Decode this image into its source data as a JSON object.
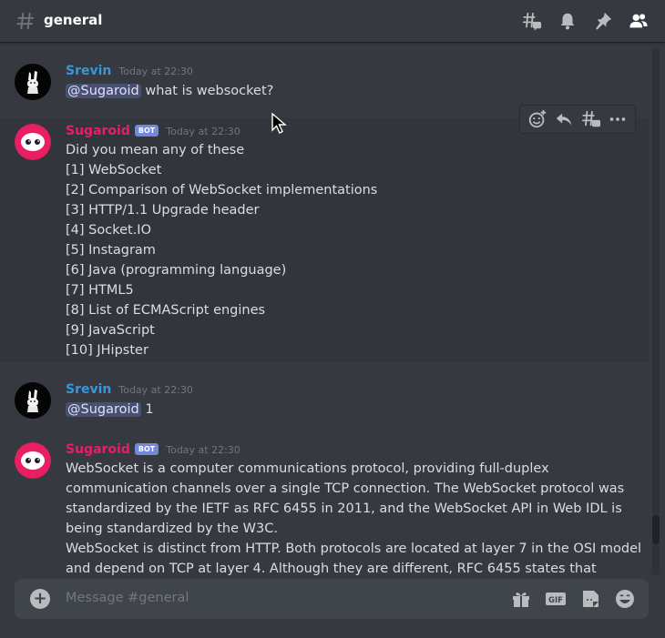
{
  "header": {
    "channel": "general",
    "icons": [
      "threads-icon",
      "bell-icon",
      "pin-icon",
      "members-icon"
    ]
  },
  "messages": [
    {
      "author": "Srevin",
      "timestamp": "Today at 22:30",
      "mention": "@Sugaroid",
      "text": " what is websocket?"
    },
    {
      "author": "Sugaroid",
      "bot_tag": "BOT",
      "timestamp": "Today at 22:30",
      "lines": [
        "Did you mean any of these",
        "[1] WebSocket",
        "[2] Comparison of WebSocket implementations",
        "[3] HTTP/1.1 Upgrade header",
        "[4] Socket.IO",
        "[5] Instagram",
        "[6] Java (programming language)",
        "[7] HTML5",
        "[8] List of ECMAScript engines",
        "[9] JavaScript",
        "[10] JHipster"
      ]
    },
    {
      "author": "Srevin",
      "timestamp": "Today at 22:30",
      "mention": "@Sugaroid",
      "text": " 1"
    },
    {
      "author": "Sugaroid",
      "bot_tag": "BOT",
      "timestamp": "Today at 22:30",
      "lines": [
        "WebSocket is a computer communications protocol, providing full-duplex",
        "communication channels over a single TCP connection. The WebSocket protocol was",
        "standardized by the IETF as RFC 6455 in 2011, and the WebSocket API in Web IDL is",
        "being standardized by the W3C.",
        "WebSocket is distinct from HTTP. Both protocols are located at layer 7 in the OSI model",
        "and depend on TCP at layer 4. Although they are different, RFC 6455 states that"
      ]
    }
  ],
  "toolbar": {
    "icons": [
      "add-reaction-icon",
      "reply-icon",
      "create-thread-icon",
      "more-icon"
    ]
  },
  "composer": {
    "placeholder": "Message #general",
    "gif_label": "GIF",
    "icons": [
      "gift-icon",
      "gif-icon",
      "sticker-icon",
      "emoji-icon"
    ]
  },
  "colors": {
    "background": "#36393f",
    "srevin": "#3498db",
    "sugaroid": "#e91e63",
    "bot_tag": "#7289da",
    "mention": "#7289da"
  }
}
